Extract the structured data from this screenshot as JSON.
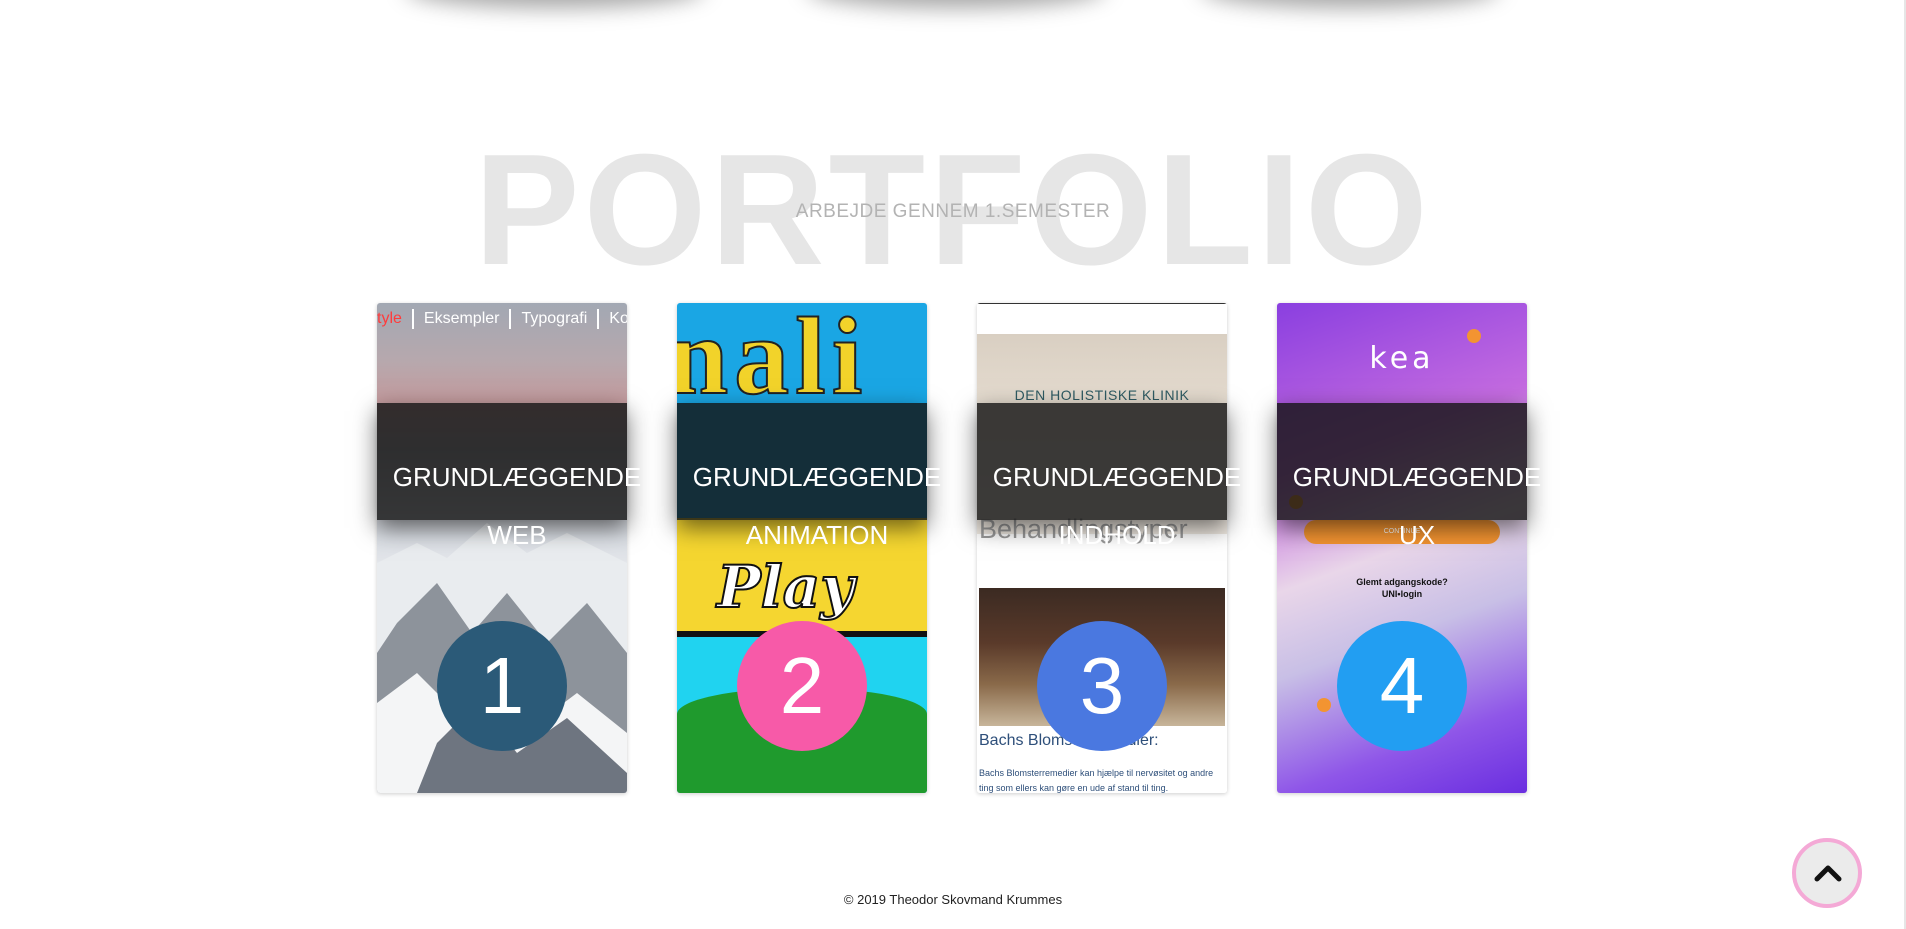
{
  "hero": {
    "title": "PORTFOLIO",
    "subtitle": "ARBEJDE GENNEM 1.SEMESTER"
  },
  "cards": [
    {
      "title_line1": "GRUNDLÆGGENDE",
      "title_line2": "WEB",
      "number": "1",
      "number_color": "#2b5a78",
      "preview_nav": [
        "tyle",
        "Eksempler",
        "Typografi",
        "Ko"
      ]
    },
    {
      "title_line1": "GRUNDLÆGGENDE",
      "title_line2": "ANIMATION",
      "number": "2",
      "number_color": "#f75aa8",
      "preview_text": "Play"
    },
    {
      "title_line1": "GRUNDLÆGGENDE",
      "title_line2": "INDHOLD",
      "number": "3",
      "number_color": "#4a78e0",
      "preview_clinic": "DEN HOLISTISKE KLINIK",
      "preview_heading": "Behandlingstyper",
      "preview_subheading": "Bachs Blomsterremedier:",
      "preview_body": "Bachs Blomsterremedier kan hjælpe til nervøsitet og andre ting som ellers kan gøre en ude af stand til ting."
    },
    {
      "title_line1": "GRUNDLÆGGENDE",
      "title_line2": "UX",
      "number": "4",
      "number_color": "#229ef2",
      "preview_logo": "kea",
      "preview_button": "CONTINUE",
      "preview_link1": "Glemt adgangskode?",
      "preview_link2": "UNI•login"
    }
  ],
  "footer": {
    "copyright": "© 2019 Theodor Skovmand Krummes"
  },
  "scroll_top": {
    "icon": "chevron-up-icon",
    "ring_color": "#f4a9d6"
  }
}
